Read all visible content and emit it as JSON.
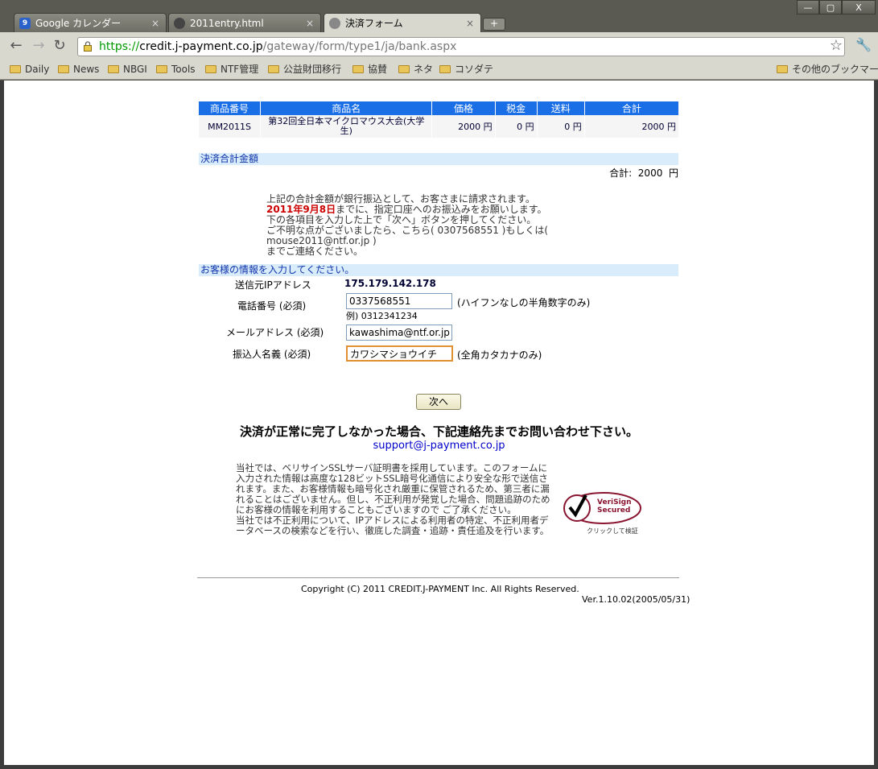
{
  "window": {
    "controls": {
      "minimize": "—",
      "maximize": "▢",
      "close": "X"
    }
  },
  "tabs": [
    {
      "label": "Google カレンダー",
      "close": "×",
      "icon": "calendar-icon"
    },
    {
      "label": "2011entry.html",
      "close": "×",
      "icon": "globe-icon"
    },
    {
      "label": "決済フォーム",
      "close": "×",
      "icon": "globe-icon"
    }
  ],
  "newtab": "+",
  "address": {
    "scheme": "https://",
    "host": "credit.j-payment.co.jp",
    "path": "/gateway/form/type1/ja/bank.aspx"
  },
  "bookmarks": [
    "Daily",
    "News",
    "NBGI",
    "Tools",
    "NTF管理",
    "公益財団移行",
    "協賛",
    "ネタ",
    "コソダテ"
  ],
  "bookmarks_other": "その他のブックマーク",
  "items": {
    "headers": [
      "商品番号",
      "商品名",
      "価格",
      "税金",
      "送料",
      "合計"
    ],
    "row": [
      "MM2011S",
      "第32回全日本マイクロマウス大会(大学生)",
      "2000 円",
      "0 円",
      "0 円",
      "2000 円"
    ]
  },
  "summary": {
    "section_title": "決済合計金額",
    "total_label": "合計:",
    "total_value": "2000",
    "total_unit": "円"
  },
  "notice": {
    "line1": "上記の合計金額が銀行振込として、お客さまに請求されます。",
    "deadline": "2011年9月8日",
    "line2_rest": "までに、指定口座へのお振込みをお願いします。",
    "line3": "下の各項目を入力した上で「次へ」ボタンを押してください。",
    "line4": "ご不明な点がございましたら、こちら( 0307568551 )もしくは( mouse2011@ntf.or.jp )",
    "line5": "までご連絡ください。"
  },
  "form": {
    "section_title": "お客様の情報を入力してください。",
    "ip_label": "送信元IPアドレス",
    "ip_value": "175.179.142.178",
    "phone_label": "電話番号 (必須)",
    "phone_value": "0337568551",
    "phone_hint": "(ハイフンなしの半角数字のみ)",
    "phone_example": "例) 0312341234",
    "email_label": "メールアドレス (必須)",
    "email_value": "kawashima@ntf.or.jp",
    "name_label": "振込人名義 (必須)",
    "name_value": "カワシマショウイチ",
    "name_hint": "(全角カタカナのみ)",
    "next_button": "次へ"
  },
  "footer": {
    "error_message": "決済が正常に完了しなかった場合、下記連絡先までお問い合わせ下さい。",
    "support_email": "support@j-payment.co.jp",
    "security_text_1": "当社では、ベリサインSSLサーバ証明書を採用しています。このフォームに入力された情報は高度な128ビットSSL暗号化通信により安全な形で送信されます。また、お客様情報も暗号化され厳重に保管されるため、第三者に漏れることはございません。但し、不正利用が発覚した場合、問題追跡のためにお客様の情報を利用することもございますので ご了承ください。",
    "security_text_2": "当社では不正利用について、IPアドレスによる利用者の特定、不正利用者データベースの検索などを行い、徹底した調査・追跡・責任追及を行います。",
    "verisign_line1": "VeriSign",
    "verisign_line2": "Secured",
    "verisign_caption": "クリックして検証",
    "copyright": "Copyright (C) 2011 CREDIT.J-PAYMENT Inc. All Rights Reserved.",
    "version": "Ver.1.10.02(2005/05/31)"
  }
}
